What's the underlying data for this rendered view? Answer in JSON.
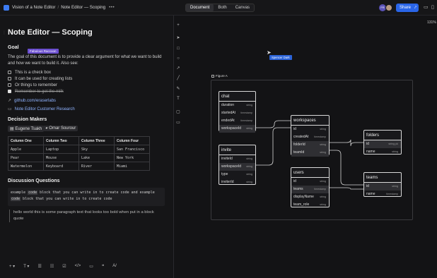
{
  "topbar": {
    "breadcrumb": [
      "Vision of a Note Editor",
      "Note Editor — Scoping"
    ],
    "more": "•••",
    "view_tabs": [
      "Document",
      "Both",
      "Canvas"
    ],
    "active_view": "Document",
    "avatar_initials": "FR",
    "share_label": "Share"
  },
  "doc": {
    "title": "Note Editor — Scoping",
    "goal_heading": "Goal",
    "goal_text": "The goal of this document is to provide a clear argument for what we want to build and how we want to build it. Also see:",
    "collab_cursor": "Fabulous Raccoon",
    "checklist": [
      {
        "text": "This is a check box",
        "checked": false
      },
      {
        "text": "It can be used for creating lists",
        "checked": false
      },
      {
        "text": "Or things to remember",
        "checked": false
      },
      {
        "text": "Remember to get the milk",
        "checked": true
      }
    ],
    "links": [
      "github.com/eraserlabs",
      "Note Editor Customer Research"
    ],
    "decision_heading": "Decision Makers",
    "decision_makers": [
      "Eugene Tsakh",
      "Omar Sourour"
    ],
    "table": {
      "headers": [
        "Column One",
        "Column Two",
        "Column Three",
        "Column Four"
      ],
      "rows": [
        [
          "Apple",
          "Laptop",
          "Sky",
          "San Francisco"
        ],
        [
          "Pear",
          "Mouse",
          "Lake",
          "New York"
        ],
        [
          "Watermelon",
          "Keyboard",
          "River",
          "Miami"
        ]
      ]
    },
    "discussion_heading": "Discussion Questions",
    "code_line1_pre": "example",
    "code_kw": "code",
    "code_line1_post": "block that you can write in to create code and example",
    "code_line2": "block that you can write in to create code",
    "quote": "hello world this is some paragraph text that looks too bold when put in a block quote",
    "bottom_tools": [
      "+ ▾",
      "T ▾",
      "☰",
      "☷",
      "☑",
      "</>",
      "▭",
      "❝",
      "A/"
    ]
  },
  "canvas": {
    "zoom": "131%",
    "collab_cursor": "Spencer Dark",
    "frame_label": "Figure A",
    "toolbar_icons": [
      "plus-icon",
      "pointer-icon",
      "rectangle-icon",
      "circle-icon",
      "arrow-icon",
      "line-icon",
      "pen-icon",
      "text-icon",
      "frame-icon",
      "comment-icon"
    ],
    "entities": {
      "chat": {
        "name": "chat",
        "fields": [
          [
            "duration",
            "string"
          ],
          [
            "startedAt",
            "timestamp"
          ],
          [
            "endedAt",
            "timestamp"
          ],
          [
            "workspaceId",
            "string"
          ]
        ]
      },
      "invite": {
        "name": "invite",
        "fields": [
          [
            "inviteId",
            "string"
          ],
          [
            "workspaceId",
            "string"
          ],
          [
            "type",
            "string"
          ],
          [
            "inviterId",
            "string"
          ]
        ]
      },
      "workspaces": {
        "name": "workspaces",
        "fields": [
          [
            "id",
            "string"
          ],
          [
            "createdAt",
            "timestamp"
          ],
          [
            "folderId",
            "string"
          ],
          [
            "teamId",
            "string"
          ]
        ]
      },
      "users": {
        "name": "users",
        "fields": [
          [
            "id",
            "string"
          ],
          [
            "teams",
            "timestamp"
          ],
          [
            "displayName",
            "string"
          ],
          [
            "team_role",
            "string"
          ]
        ]
      },
      "folders": {
        "name": "folders",
        "fields": [
          [
            "id",
            "string pk"
          ],
          [
            "name",
            "string"
          ]
        ]
      },
      "teams": {
        "name": "teams",
        "fields": [
          [
            "id",
            "string"
          ],
          [
            "name",
            "timestamp"
          ]
        ]
      }
    }
  }
}
